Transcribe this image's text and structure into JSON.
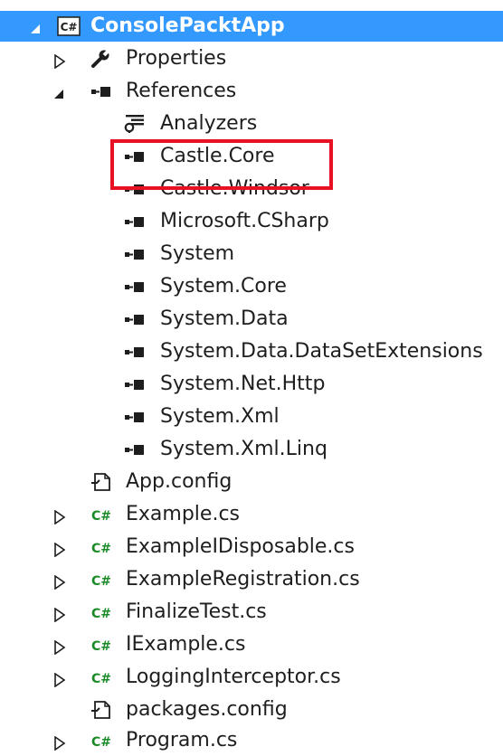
{
  "colors": {
    "selection": "#3399ff",
    "selection_text": "#ffffff",
    "text": "#1e1e1e",
    "highlight_border": "#e81123",
    "csharp_icon": "#1a8a26"
  },
  "solution_explorer": {
    "project": {
      "label": "ConsolePacktApp",
      "icon": "csharp-project-icon",
      "expanded": true,
      "selected": true
    },
    "properties": {
      "label": "Properties",
      "icon": "wrench-icon",
      "expanded": false
    },
    "references": {
      "label": "References",
      "icon": "reference-icon",
      "expanded": true,
      "analyzers": {
        "label": "Analyzers",
        "icon": "analyzer-icon"
      },
      "items": [
        {
          "label": "Castle.Core",
          "icon": "reference-icon",
          "highlighted": true
        },
        {
          "label": "Castle.Windsor",
          "icon": "reference-icon",
          "highlighted": true
        },
        {
          "label": "Microsoft.CSharp",
          "icon": "reference-icon"
        },
        {
          "label": "System",
          "icon": "reference-icon"
        },
        {
          "label": "System.Core",
          "icon": "reference-icon"
        },
        {
          "label": "System.Data",
          "icon": "reference-icon"
        },
        {
          "label": "System.Data.DataSetExtensions",
          "icon": "reference-icon"
        },
        {
          "label": "System.Net.Http",
          "icon": "reference-icon"
        },
        {
          "label": "System.Xml",
          "icon": "reference-icon"
        },
        {
          "label": "System.Xml.Linq",
          "icon": "reference-icon"
        }
      ]
    },
    "files": [
      {
        "label": "App.config",
        "icon": "config-file-icon",
        "expandable": false
      },
      {
        "label": "Example.cs",
        "icon": "csharp-file-icon",
        "expandable": true
      },
      {
        "label": "ExampleIDisposable.cs",
        "icon": "csharp-file-icon",
        "expandable": true
      },
      {
        "label": "ExampleRegistration.cs",
        "icon": "csharp-file-icon",
        "expandable": true
      },
      {
        "label": "FinalizeTest.cs",
        "icon": "csharp-file-icon",
        "expandable": true
      },
      {
        "label": "IExample.cs",
        "icon": "csharp-file-icon",
        "expandable": true
      },
      {
        "label": "LoggingInterceptor.cs",
        "icon": "csharp-file-icon",
        "expandable": true
      },
      {
        "label": "packages.config",
        "icon": "config-file-icon",
        "expandable": false
      },
      {
        "label": "Program.cs",
        "icon": "csharp-file-icon",
        "expandable": true
      }
    ]
  }
}
